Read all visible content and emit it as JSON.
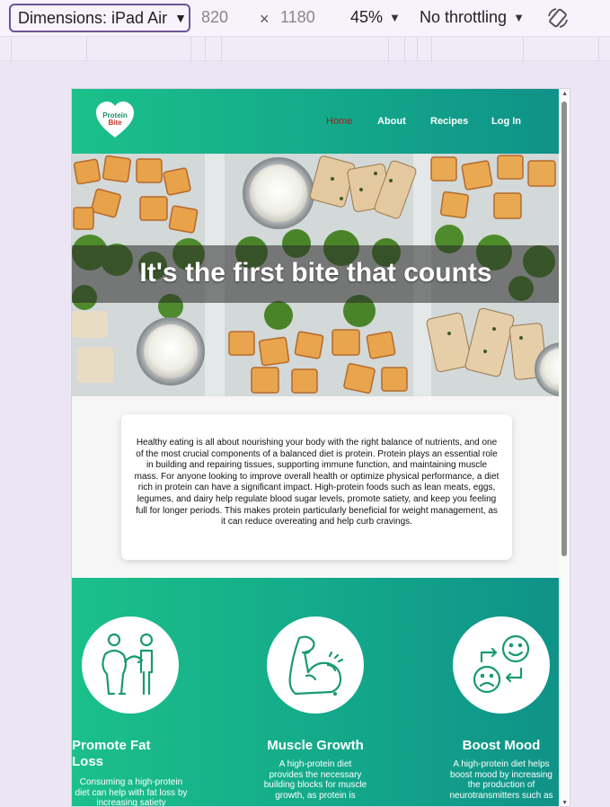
{
  "toolbar": {
    "dimensions_label": "Dimensions: iPad Air",
    "width": "820",
    "height": "1180",
    "times": "×",
    "zoom": "45%",
    "throttling": "No throttling"
  },
  "site": {
    "logo": {
      "line1": "Protein",
      "line2": "Bite"
    },
    "nav": [
      "Home",
      "About",
      "Recipes",
      "Log In"
    ],
    "hero_title": "It's the first bite that counts",
    "intro": "Healthy eating is all about nourishing your body with the right balance of nutrients, and one of the most crucial components of a balanced diet is protein. Protein plays an essential role in building and repairing tissues, supporting immune function, and maintaining muscle mass. For anyone looking to improve overall health or optimize physical performance, a diet rich in protein can have a significant impact. High-protein foods such as lean meats, eggs, legumes, and dairy help regulate blood sugar levels, promote satiety, and keep you feeling full for longer periods. This makes protein particularly beneficial for weight management, as it can reduce overeating and help curb cravings.",
    "features": [
      {
        "title": "Promote Fat Loss",
        "desc": "Consuming a high-protein diet can help with fat loss by increasing satiety",
        "icon": "weight-loss-icon"
      },
      {
        "title": "Muscle Growth",
        "desc": "A high-protein diet provides the necessary building blocks for muscle growth, as protein is",
        "icon": "flexed-arm-icon"
      },
      {
        "title": "Boost Mood",
        "desc": "A high-protein diet helps boost mood by increasing the production of neurotransmitters such as",
        "icon": "mood-swap-icon"
      }
    ]
  },
  "colors": {
    "accent_green": "#1bc08a",
    "teal": "#0f9288",
    "active_nav": "#9b1d1d",
    "toolbar_outline": "#6a5597"
  }
}
